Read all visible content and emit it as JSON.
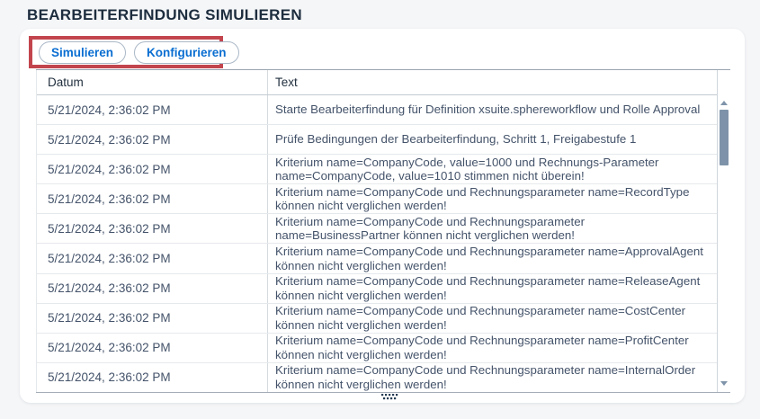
{
  "page": {
    "title": "BEARBEITERFINDUNG SIMULIEREN"
  },
  "toolbar": {
    "simulate_label": "Simulieren",
    "configure_label": "Konfigurieren"
  },
  "table": {
    "columns": {
      "datum": "Datum",
      "text": "Text"
    },
    "rows": [
      {
        "datum": "5/21/2024, 2:36:02 PM",
        "text": "Starte Bearbeiterfindung für Definition xsuite.sphereworkflow und Rolle Approval"
      },
      {
        "datum": "5/21/2024, 2:36:02 PM",
        "text": "Prüfe Bedingungen der Bearbeiterfindung, Schritt 1, Freigabestufe 1"
      },
      {
        "datum": "5/21/2024, 2:36:02 PM",
        "text": "Kriterium name=CompanyCode, value=1000 und Rechnungs-Parameter name=CompanyCode, value=1010 stimmen nicht überein!"
      },
      {
        "datum": "5/21/2024, 2:36:02 PM",
        "text": "Kriterium name=CompanyCode und Rechnungsparameter name=RecordType können nicht verglichen werden!"
      },
      {
        "datum": "5/21/2024, 2:36:02 PM",
        "text": "Kriterium name=CompanyCode und Rechnungsparameter name=BusinessPartner können nicht verglichen werden!"
      },
      {
        "datum": "5/21/2024, 2:36:02 PM",
        "text": "Kriterium name=CompanyCode und Rechnungsparameter name=ApprovalAgent können nicht verglichen werden!"
      },
      {
        "datum": "5/21/2024, 2:36:02 PM",
        "text": "Kriterium name=CompanyCode und Rechnungsparameter name=ReleaseAgent können nicht verglichen werden!"
      },
      {
        "datum": "5/21/2024, 2:36:02 PM",
        "text": "Kriterium name=CompanyCode und Rechnungsparameter name=CostCenter können nicht verglichen werden!"
      },
      {
        "datum": "5/21/2024, 2:36:02 PM",
        "text": "Kriterium name=CompanyCode und Rechnungsparameter name=ProfitCenter können nicht verglichen werden!"
      },
      {
        "datum": "5/21/2024, 2:36:02 PM",
        "text": "Kriterium name=CompanyCode und Rechnungsparameter name=InternalOrder können nicht verglichen werden!"
      }
    ]
  },
  "colors": {
    "accent_blue": "#0a6ed1",
    "annotation_red": "#c2454e",
    "title_dark": "#1d2d3e",
    "scrollbar_thumb": "#7e93a9",
    "page_background": "#f5f6f8"
  }
}
